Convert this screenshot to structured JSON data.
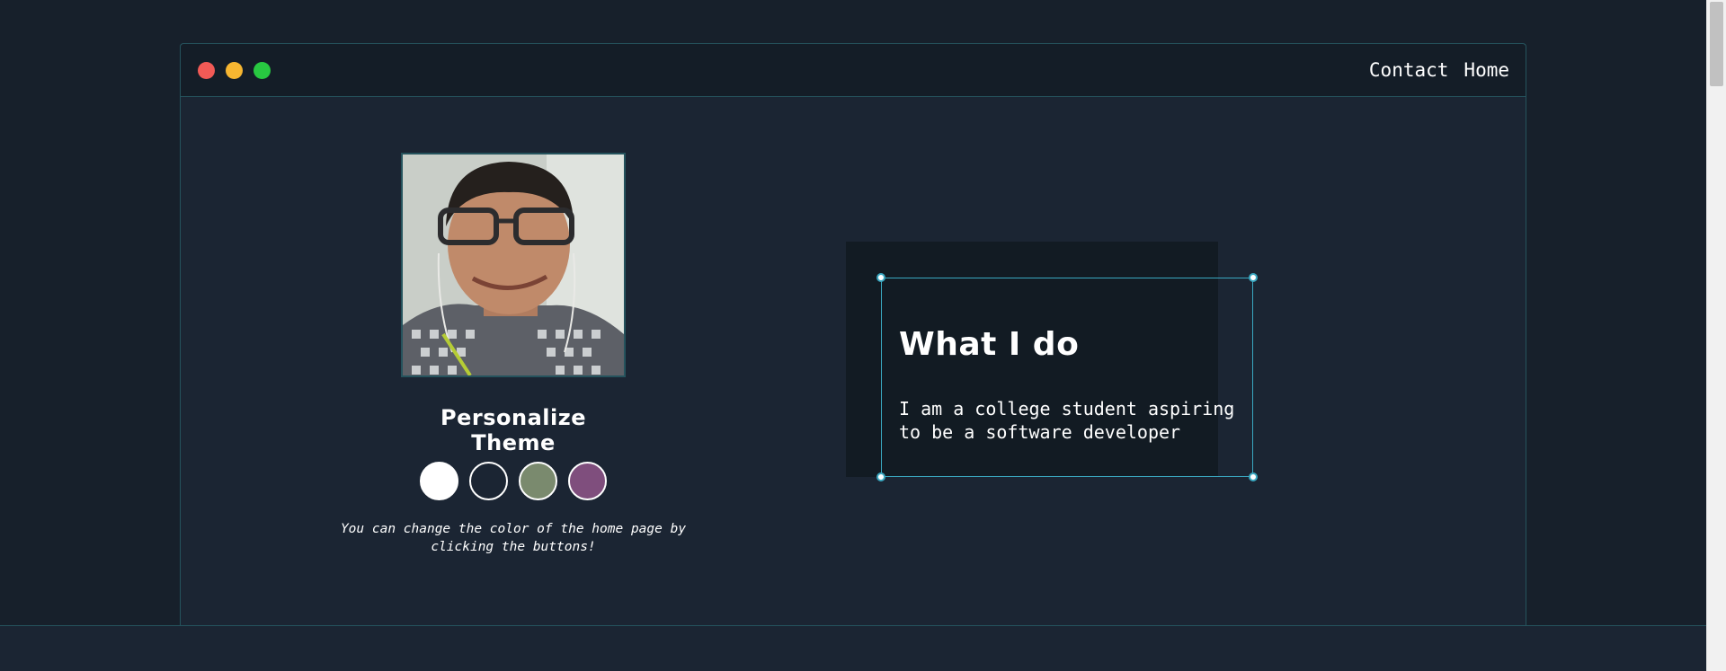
{
  "nav": {
    "contact_label": "Contact",
    "home_label": "Home"
  },
  "profile": {
    "photo_icon": "profile-photo",
    "theme_title": "Personalize Theme",
    "swatches": [
      {
        "name": "white",
        "color": "#ffffff"
      },
      {
        "name": "dark-navy",
        "color": "#1b2533"
      },
      {
        "name": "sage-green",
        "color": "#7a8a6e"
      },
      {
        "name": "plum",
        "color": "#7f4e7d"
      }
    ],
    "theme_note": "You can change the color of the home page by clicking the buttons!"
  },
  "card": {
    "title": "What I do",
    "body": "I am a college student aspiring to be a software developer"
  },
  "colors": {
    "background": "#17202b",
    "window": "#1b2533",
    "accent": "#3aa8c1",
    "close_dot": "#f25a56",
    "minimize_dot": "#f7b631",
    "maximize_dot": "#28c841"
  }
}
